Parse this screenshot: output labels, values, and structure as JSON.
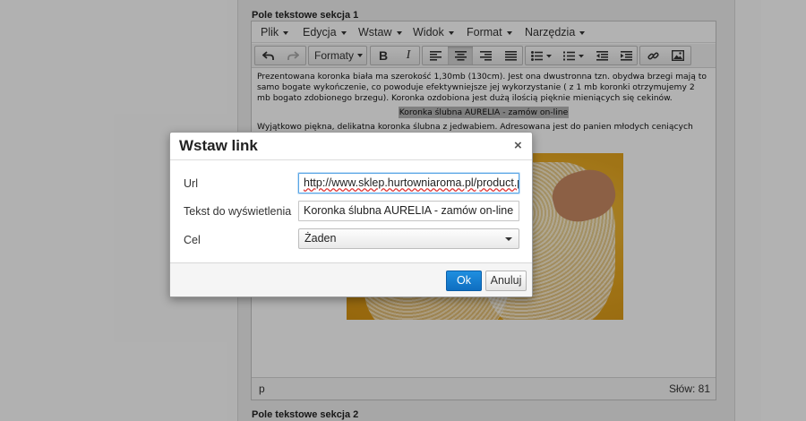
{
  "page": {
    "section1_label": "Pole tekstowe sekcja 1",
    "section2_label": "Pole tekstowe sekcja 2"
  },
  "editor": {
    "menu": [
      "Plik",
      "Edycja",
      "Wstaw",
      "Widok",
      "Format",
      "Narzędzia"
    ],
    "toolbar": {
      "formats_label": "Formaty",
      "undo_icon": "undo-icon",
      "redo_icon": "redo-icon",
      "bold_label": "B",
      "italic_label": "I"
    },
    "content": {
      "paragraph1": "Prezentowana koronka biała ma szerokość 1,30mb (130cm). Jest ona dwustronna tzn. obydwa brzegi mają to samo bogate wykończenie, co powoduje efektywniejsze jej wykorzystanie ( z 1 mb koronki otrzymujemy 2 mb bogato zdobionego brzegu). Koronka ozdobiona jest dużą ilością pięknie mieniących się cekinów.",
      "link_text": "Koronka ślubna AURELIA - zamów on-line",
      "paragraph2": "Wyjątkowo piękna, delikatna koronka ślubna z jedwabiem. Adresowana jest do panien młodych ceniących"
    },
    "status": {
      "path": "p",
      "word_count": "Słów: 81"
    }
  },
  "dialog": {
    "title": "Wstaw link",
    "close_glyph": "×",
    "url_label": "Url",
    "url_value": "http://www.sklep.hurtowniaroma.pl/product.php?p",
    "text_label": "Tekst do wyświetlenia",
    "text_value": "Koronka ślubna AURELIA - zamów on-line",
    "target_label": "Cel",
    "target_value": "Żaden",
    "ok_label": "Ok",
    "cancel_label": "Anuluj",
    "accent_color": "#1779d3"
  }
}
